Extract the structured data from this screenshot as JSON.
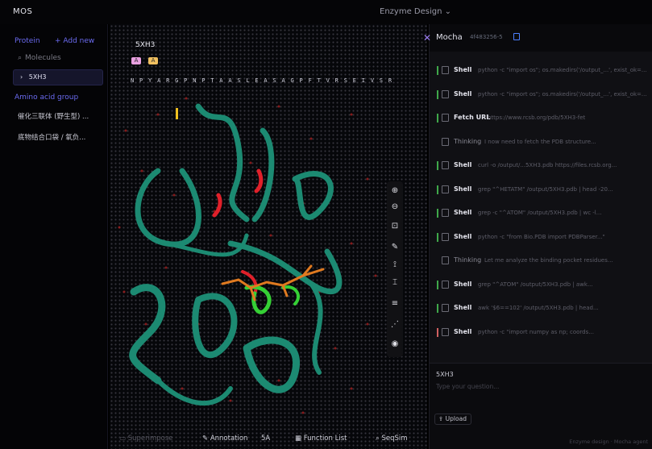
{
  "topbar": {
    "app_title": "MOS",
    "workspace_label": "Enzyme Design ⌄"
  },
  "sidebar": {
    "section_label": "Protein",
    "add_label": "+ Add new",
    "search_placeholder": "Molecules",
    "items": [
      {
        "label": "5XH3"
      }
    ],
    "group_label": "Amino acid group",
    "links": [
      {
        "label": "催化三联体 (野生型) ..."
      },
      {
        "label": "底物结合口袋 / 氧负..."
      }
    ]
  },
  "viewer": {
    "molecule_title": "5XH3",
    "chips": [
      {
        "label": "A",
        "color": "#e8a0e0"
      },
      {
        "label": "A",
        "color": "#f0c060"
      }
    ],
    "sequence": "N P Y A R G P N P T A A S L E A S A G P F T V R S E I V S R",
    "toolbar_icons": [
      "zoom-in-icon",
      "zoom-out-icon",
      "fit-view-icon",
      "pen-icon",
      "measure-icon",
      "ruler-icon",
      "layers-icon",
      "share-icon",
      "eye-icon"
    ],
    "bottom_toolbar": {
      "superimpose": "Superimpose",
      "annotation": "Annotation",
      "annotation_count": "5A",
      "function_list": "Function List",
      "seqsim": "SeqSim"
    },
    "colors": {
      "ribbon": "#1c8a72",
      "highlight": "#e0202a",
      "ligand": "#e07a20",
      "pocket": "#35d035"
    }
  },
  "panel": {
    "agent_name": "Mocha",
    "session_id": "4f483256-5",
    "log": [
      {
        "kind": "Shell",
        "cmd": "python -c \"import os\"; os.makedirs('/output_...', exist_ok=...",
        "status": "ok"
      },
      {
        "kind": "Shell",
        "cmd": "python -c \"import os\"; os.makedirs('/output_...', exist_ok=...",
        "status": "ok"
      },
      {
        "kind": "Fetch URL",
        "cmd": "https://www.rcsb.org/pdb/5XH3-fet",
        "status": "ok"
      },
      {
        "kind": "Thinking",
        "cmd": "I now need to fetch the PDB structure...",
        "status": "think"
      },
      {
        "kind": "Shell",
        "cmd": "curl -o /output/...5XH3.pdb https://files.rcsb.org...",
        "status": "ok"
      },
      {
        "kind": "Shell",
        "cmd": "grep \"^HETATM\" /output/5XH3.pdb | head -20...",
        "status": "ok"
      },
      {
        "kind": "Shell",
        "cmd": "grep -c \"^ATOM\" /output/5XH3.pdb | wc -l...",
        "status": "ok"
      },
      {
        "kind": "Shell",
        "cmd": "python -c \"from Bio.PDB import PDBParser...\"",
        "status": "ok"
      },
      {
        "kind": "Thinking",
        "cmd": "Let me analyze the binding pocket residues...",
        "status": "think"
      },
      {
        "kind": "Shell",
        "cmd": "grep \"^ATOM\" /output/5XH3.pdb | awk...",
        "status": "ok"
      },
      {
        "kind": "Shell",
        "cmd": "awk '$6==102' /output/5XH3.pdb | head...",
        "status": "ok"
      },
      {
        "kind": "Shell",
        "cmd": "python -c \"import numpy as np; coords...",
        "status": "err"
      }
    ],
    "context_label": "5XH3",
    "input_placeholder": "Type your question...",
    "upload_label": "Upload",
    "footer_text": "Enzyme design · Mocha agent"
  }
}
